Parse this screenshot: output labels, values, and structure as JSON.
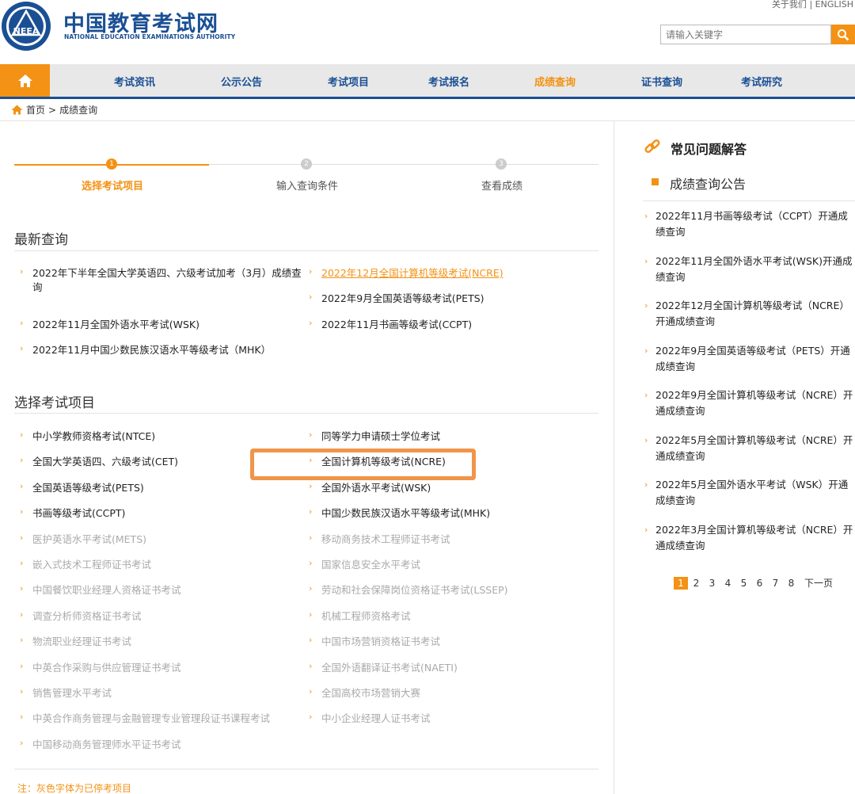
{
  "header": {
    "brand_cn": "中国教育考试网",
    "brand_en": "NATIONAL EDUCATION EXAMINATIONS AUTHORITY",
    "logo_text": "NEEA",
    "about": "关于我们",
    "sep": "|",
    "english": "ENGLISH",
    "search_placeholder": "请输入关键字"
  },
  "nav": {
    "items": [
      "考试资讯",
      "公示公告",
      "考试项目",
      "考试报名",
      "成绩查询",
      "证书查询",
      "考试研究"
    ],
    "active": "成绩查询"
  },
  "breadcrumb": {
    "home": "首页",
    "sep": ">",
    "current": "成绩查询"
  },
  "steps": [
    {
      "num": "1",
      "label": "选择考试项目"
    },
    {
      "num": "2",
      "label": "输入查询条件"
    },
    {
      "num": "3",
      "label": "查看成绩"
    }
  ],
  "latest": {
    "title": "最新查询",
    "items": [
      "2022年下半年全国大学英语四、六级考试加考（3月）成绩查询",
      "2022年12月全国计算机等级考试(NCRE)",
      "2022年9月全国英语等级考试(PETS)",
      "2022年11月全国外语水平考试(WSK)",
      "2022年11月书画等级考试(CCPT)",
      "2022年11月中国少数民族汉语水平等级考试（MHK）"
    ]
  },
  "projects": {
    "title": "选择考试项目",
    "items": [
      "中小学教师资格考试(NTCE)",
      "同等学力申请硕士学位考试",
      "全国大学英语四、六级考试(CET)",
      "全国计算机等级考试(NCRE)",
      "全国英语等级考试(PETS)",
      "全国外语水平考试(WSK)",
      "书画等级考试(CCPT)",
      "中国少数民族汉语水平等级考试(MHK)",
      "医护英语水平考试(METS)",
      "移动商务技术工程师证书考试",
      "嵌入式技术工程师证书考试",
      "国家信息安全水平考试",
      "中国餐饮职业经理人资格证书考试",
      "劳动和社会保障岗位资格证书考试(LSSEP)",
      "调查分析师资格证书考试",
      "机械工程师资格考试",
      "物流职业经理证书考试",
      "中国市场营销资格证书考试",
      "中英合作采购与供应管理证书考试",
      "全国外语翻译证书考试(NAETI)",
      "销售管理水平考试",
      "全国高校市场营销大赛",
      "中英合作商务管理与金融管理专业管理段证书课程考试",
      "中小企业经理人证书考试",
      "中国移动商务管理师水平证书考试"
    ],
    "note": "注：灰色字体为已停考项目"
  },
  "right": {
    "faq_title": "常见问题解答",
    "ann_title": "成绩查询公告",
    "news": [
      "2022年11月书画等级考试（CCPT）开通成绩查询",
      "2022年11月全国外语水平考试(WSK)开通成绩查询",
      "2022年12月全国计算机等级考试（NCRE）开通成绩查询",
      "2022年9月全国英语等级考试（PETS）开通成绩查询",
      "2022年9月全国计算机等级考试（NCRE）开通成绩查询",
      "2022年5月全国计算机等级考试（NCRE）开通成绩查询",
      "2022年5月全国外语水平考试（WSK）开通成绩查询",
      "2022年3月全国计算机等级考试（NCRE）开通成绩查询"
    ],
    "pager": [
      "1",
      "2",
      "3",
      "4",
      "5",
      "6",
      "7",
      "8",
      "下一页"
    ]
  },
  "colors": {
    "accent": "#f39214",
    "brand": "#1a4f94"
  }
}
